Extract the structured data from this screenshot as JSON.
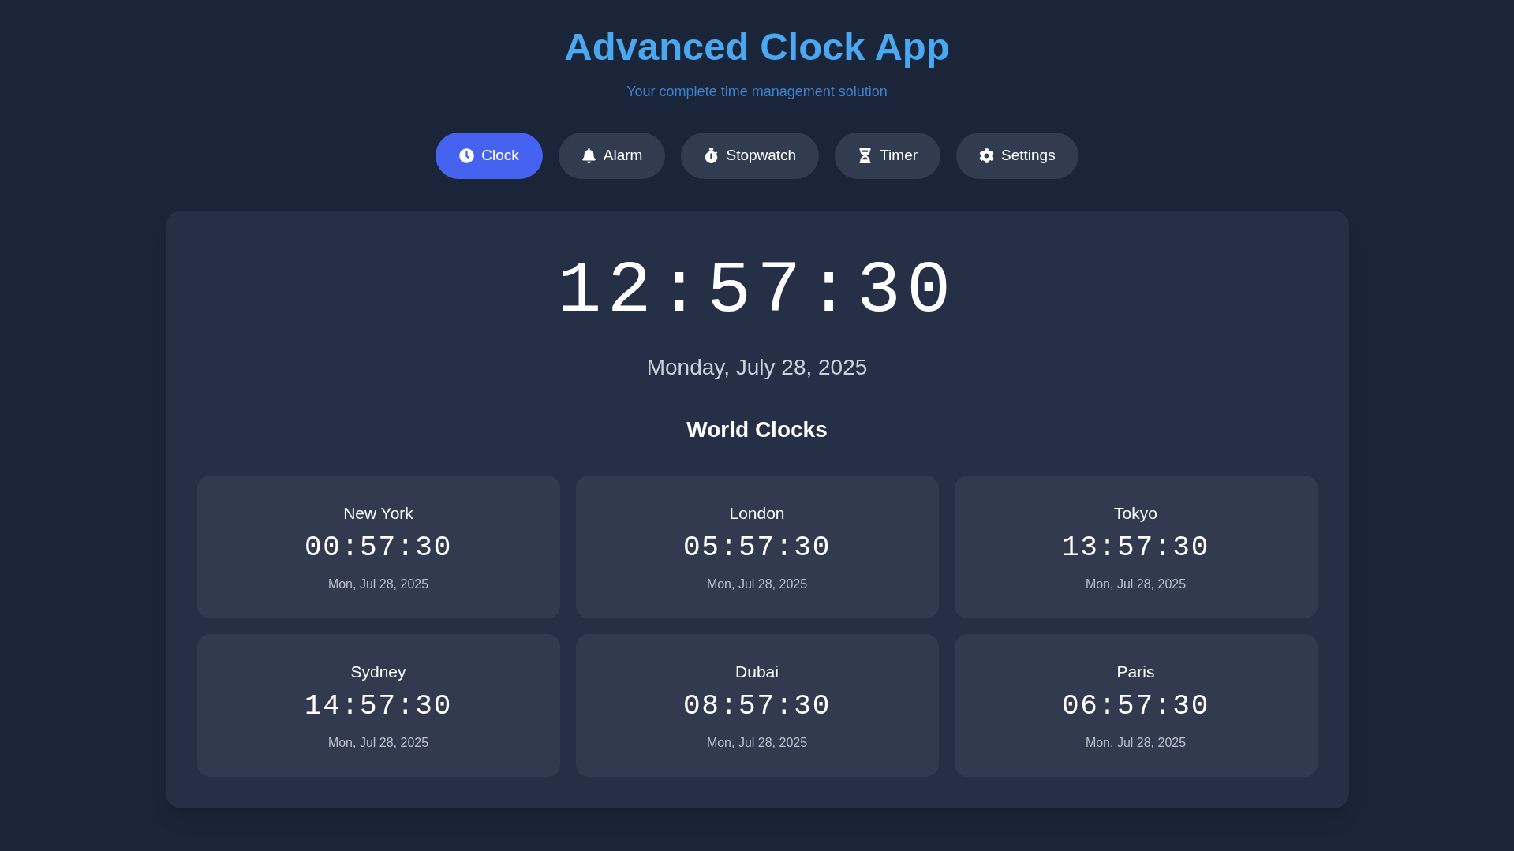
{
  "header": {
    "title": "Advanced Clock App",
    "subtitle": "Your complete time management solution"
  },
  "tabs": [
    {
      "label": "Clock",
      "selected": true
    },
    {
      "label": "Alarm",
      "selected": false
    },
    {
      "label": "Stopwatch",
      "selected": false
    },
    {
      "label": "Timer",
      "selected": false
    },
    {
      "label": "Settings",
      "selected": false
    }
  ],
  "clock": {
    "time": "12:57:30",
    "date": "Monday, July 28, 2025"
  },
  "world_clocks": {
    "title": "World Clocks",
    "cities": [
      {
        "name": "New York",
        "time": "00:57:30",
        "date": "Mon, Jul 28, 2025"
      },
      {
        "name": "London",
        "time": "05:57:30",
        "date": "Mon, Jul 28, 2025"
      },
      {
        "name": "Tokyo",
        "time": "13:57:30",
        "date": "Mon, Jul 28, 2025"
      },
      {
        "name": "Sydney",
        "time": "14:57:30",
        "date": "Mon, Jul 28, 2025"
      },
      {
        "name": "Dubai",
        "time": "08:57:30",
        "date": "Mon, Jul 28, 2025"
      },
      {
        "name": "Paris",
        "time": "06:57:30",
        "date": "Mon, Jul 28, 2025"
      }
    ]
  }
}
